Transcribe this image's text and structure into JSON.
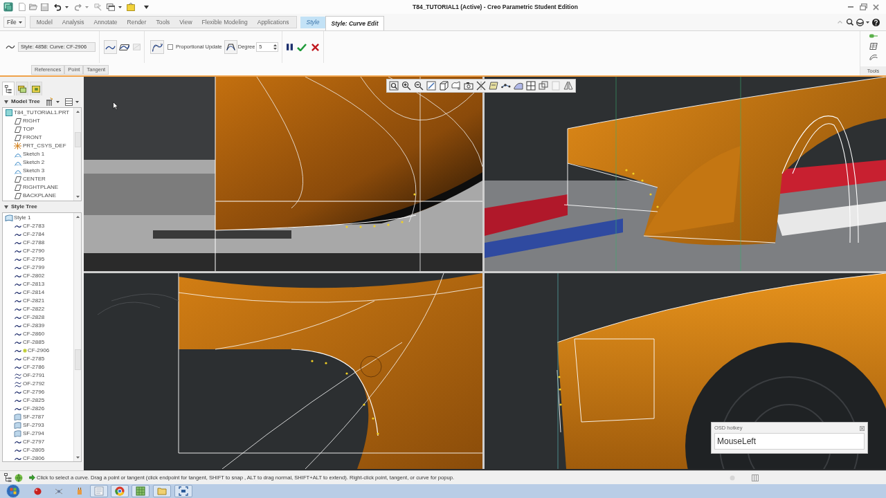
{
  "window": {
    "title": "T84_TUTORIAL1 (Active) - Creo Parametric Student Edition"
  },
  "ribbon_tabs": [
    {
      "label": "File",
      "kind": "file",
      "selected": false
    },
    {
      "label": "Model",
      "kind": "main",
      "selected": false
    },
    {
      "label": "Analysis",
      "kind": "main",
      "selected": false
    },
    {
      "label": "Annotate",
      "kind": "main",
      "selected": false
    },
    {
      "label": "Render",
      "kind": "main",
      "selected": false
    },
    {
      "label": "Tools",
      "kind": "main",
      "selected": false
    },
    {
      "label": "View",
      "kind": "main",
      "selected": false
    },
    {
      "label": "Flexible Modeling",
      "kind": "main",
      "selected": false
    },
    {
      "label": "Applications",
      "kind": "main",
      "selected": false
    },
    {
      "label": "Style",
      "kind": "context",
      "selected": false
    },
    {
      "label": "Style: Curve Edit",
      "kind": "context",
      "selected": true
    }
  ],
  "ribbon": {
    "curve_field": {
      "value": "Style: 4858: Curve: CF-2906"
    },
    "proportional_update": {
      "label": "Proportional Update",
      "checked": false
    },
    "degree": {
      "label": "Degree",
      "value": "5"
    },
    "panel_tabs": [
      {
        "label": "References"
      },
      {
        "label": "Point"
      },
      {
        "label": "Tangent"
      }
    ],
    "tools_group": {
      "label": "Tools"
    }
  },
  "navigator_tabs": [
    {
      "selected": true
    },
    {
      "selected": false
    },
    {
      "selected": false
    }
  ],
  "model_tree": {
    "title": "Model Tree",
    "expanded": true,
    "items": [
      {
        "label": "T84_TUTORIAL1.PRT",
        "kind": "part",
        "children": [
          {
            "label": "RIGHT",
            "kind": "plane"
          },
          {
            "label": "TOP",
            "kind": "plane"
          },
          {
            "label": "FRONT",
            "kind": "plane"
          },
          {
            "label": "PRT_CSYS_DEF",
            "kind": "csys"
          },
          {
            "label": "Sketch 1",
            "kind": "sketch"
          },
          {
            "label": "Sketch 2",
            "kind": "sketch"
          },
          {
            "label": "Sketch 3",
            "kind": "sketch"
          },
          {
            "label": "CENTER",
            "kind": "plane"
          },
          {
            "label": "RIGHTPLANE",
            "kind": "plane"
          },
          {
            "label": "BACKPLANE",
            "kind": "plane"
          }
        ]
      }
    ]
  },
  "style_tree": {
    "title": "Style Tree",
    "expanded": true,
    "items": [
      {
        "label": "Style 1",
        "kind": "style",
        "active": false,
        "children": [
          {
            "label": "CF-2783",
            "kind": "curve",
            "active": false
          },
          {
            "label": "CF-2784",
            "kind": "curve",
            "active": false
          },
          {
            "label": "CF-2788",
            "kind": "curve",
            "active": false
          },
          {
            "label": "CF-2790",
            "kind": "curve",
            "active": false
          },
          {
            "label": "CF-2795",
            "kind": "curve",
            "active": false
          },
          {
            "label": "CF-2799",
            "kind": "curve",
            "active": false
          },
          {
            "label": "CF-2802",
            "kind": "curve",
            "active": false
          },
          {
            "label": "CF-2813",
            "kind": "curve",
            "active": false
          },
          {
            "label": "CF-2814",
            "kind": "curve",
            "active": false
          },
          {
            "label": "CF-2821",
            "kind": "curve",
            "active": false
          },
          {
            "label": "CF-2822",
            "kind": "curve",
            "active": false
          },
          {
            "label": "CF-2828",
            "kind": "curve",
            "active": false
          },
          {
            "label": "CF-2839",
            "kind": "curve",
            "active": false
          },
          {
            "label": "CF-2860",
            "kind": "curve",
            "active": false
          },
          {
            "label": "CF-2885",
            "kind": "curve",
            "active": false
          },
          {
            "label": "CF-2906",
            "kind": "curve",
            "active": true
          },
          {
            "label": "CF-2785",
            "kind": "curve",
            "active": false
          },
          {
            "label": "CF-2786",
            "kind": "curve",
            "active": false
          },
          {
            "label": "OF-2791",
            "kind": "offset",
            "active": false
          },
          {
            "label": "OF-2792",
            "kind": "offset",
            "active": false
          },
          {
            "label": "CF-2796",
            "kind": "curve",
            "active": false
          },
          {
            "label": "CF-2825",
            "kind": "curve",
            "active": false
          },
          {
            "label": "CF-2826",
            "kind": "curve",
            "active": false
          },
          {
            "label": "SF-2787",
            "kind": "surface",
            "active": false
          },
          {
            "label": "SF-2793",
            "kind": "surface",
            "active": false
          },
          {
            "label": "SF-2794",
            "kind": "surface",
            "active": false
          },
          {
            "label": "CF-2797",
            "kind": "curve",
            "active": false
          },
          {
            "label": "CF-2805",
            "kind": "curve",
            "active": false
          },
          {
            "label": "CF-2806",
            "kind": "curve",
            "active": false
          }
        ]
      }
    ]
  },
  "osd_hotkey": {
    "title": "OSD hotkey",
    "key": "MouseLeft"
  },
  "status_bar": {
    "message": "Click to select a curve. Drag a point or tangent (click endpoint for tangent, SHIFT to snap , ALT to drag normal, SHIFT+ALT to extend). Right-click point, tangent, or curve for popup."
  }
}
